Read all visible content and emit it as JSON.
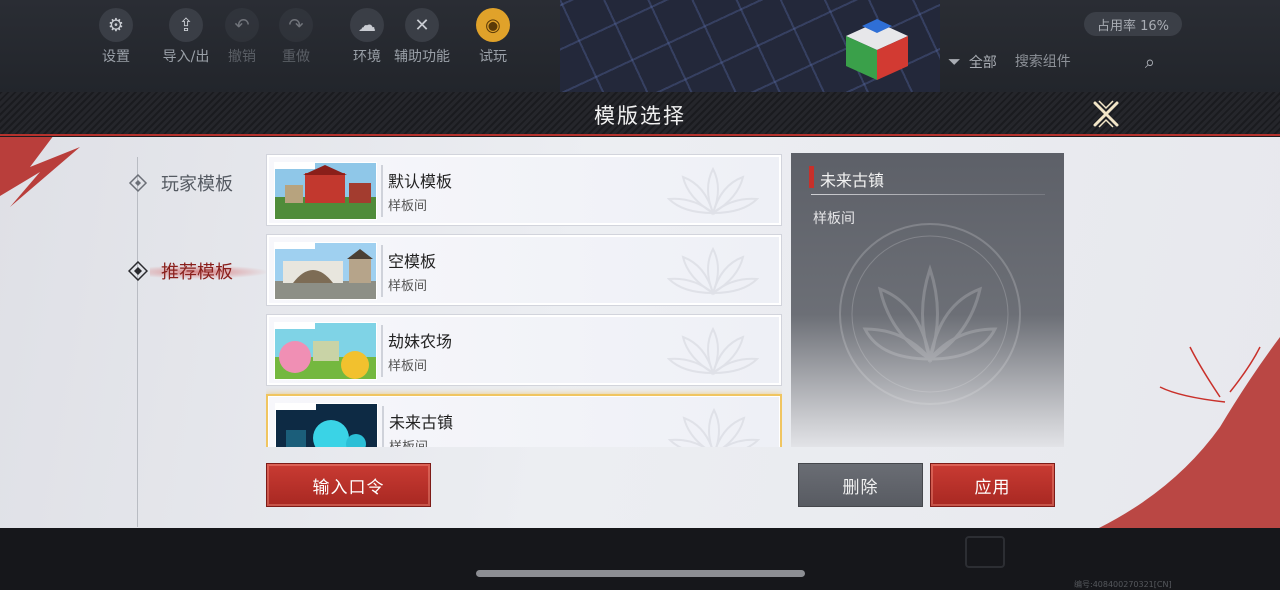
{
  "toolbar": {
    "items": [
      {
        "label": "设置",
        "icon": "gear-icon",
        "glyph": "⚙"
      },
      {
        "label": "导入/出",
        "icon": "import-export-icon",
        "glyph": "⇪"
      },
      {
        "label": "撤销",
        "icon": "undo-icon",
        "glyph": "↶"
      },
      {
        "label": "重做",
        "icon": "redo-icon",
        "glyph": "↷"
      },
      {
        "label": "环境",
        "icon": "environment-icon",
        "glyph": "☁"
      },
      {
        "label": "辅助功能",
        "icon": "tools-icon",
        "glyph": "✕"
      },
      {
        "label": "试玩",
        "icon": "gamepad-icon",
        "glyph": "◉"
      }
    ],
    "usage": "占用率 16%",
    "filter_label": "全部",
    "search_placeholder": "搜索组件"
  },
  "dialog": {
    "title": "模版选择",
    "nav": [
      {
        "label": "玩家模板",
        "active": false
      },
      {
        "label": "推荐模板",
        "active": true
      }
    ],
    "templates": [
      {
        "name": "默认模板",
        "sub": "样板间",
        "selected": false
      },
      {
        "name": "空模板",
        "sub": "样板间",
        "selected": false
      },
      {
        "name": "劫妹农场",
        "sub": "样板间",
        "selected": false
      },
      {
        "name": "未来古镇",
        "sub": "样板间",
        "selected": true
      }
    ],
    "detail": {
      "title": "未来古镇",
      "desc": "样板间"
    },
    "buttons": {
      "input_code": "输入口令",
      "delete": "删除",
      "apply": "应用"
    }
  },
  "footer": {
    "build_no": "编号:408400270321[CN]"
  },
  "colors": {
    "accent_red": "#c93b33",
    "selected_gold": "#f0c560",
    "header_border": "#b5322d"
  }
}
